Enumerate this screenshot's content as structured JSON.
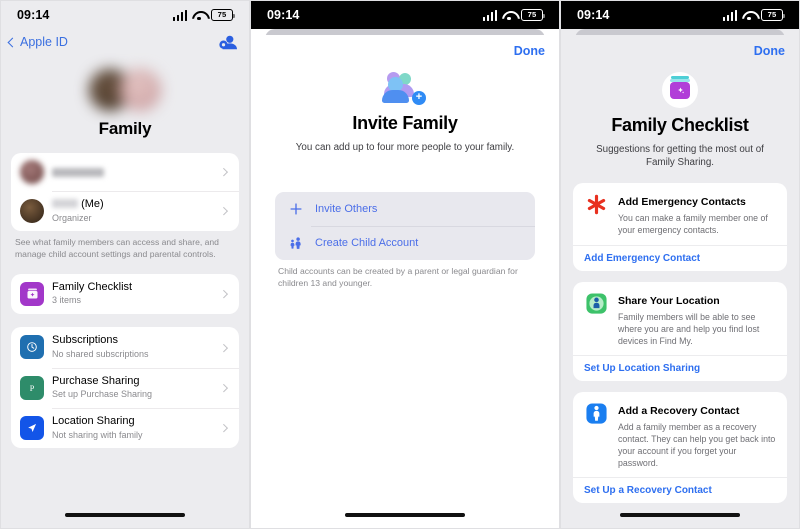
{
  "status_bar": {
    "time": "09:14",
    "battery": "75",
    "signal_icon": "cellular-bars-icon",
    "wifi_icon": "wifi-icon",
    "battery_icon": "battery-icon"
  },
  "screen1": {
    "back_label": "Apple ID",
    "add_member_icon": "add-person-icon",
    "title": "Family",
    "members": [
      {
        "name": "",
        "subtitle": "",
        "blurred": true
      },
      {
        "name": "(Me)",
        "subtitle": "Organizer",
        "blurred": false
      }
    ],
    "members_footnote": "See what family members can access and share, and manage child account settings and parental controls.",
    "checklist": {
      "title": "Family Checklist",
      "subtitle": "3 items",
      "icon": "checklist-jar-icon"
    },
    "features": [
      {
        "title": "Subscriptions",
        "subtitle": "No shared subscriptions",
        "icon": "subscriptions-icon",
        "color": "#1f6fb0"
      },
      {
        "title": "Purchase Sharing",
        "subtitle": "Set up Purchase Sharing",
        "icon": "purchase-sharing-icon",
        "color": "#2e8c6a"
      },
      {
        "title": "Location Sharing",
        "subtitle": "Not sharing with family",
        "icon": "location-arrow-icon",
        "color": "#1355e8"
      }
    ]
  },
  "screen2": {
    "done_label": "Done",
    "hero_icon": "invite-family-icon",
    "title": "Invite Family",
    "subtitle": "You can add up to four more people to your family.",
    "options": [
      {
        "label": "Invite Others",
        "icon": "plus-icon"
      },
      {
        "label": "Create Child Account",
        "icon": "child-account-icon"
      }
    ],
    "options_footnote": "Child accounts can be created by a parent or legal guardian for children 13 and younger."
  },
  "screen3": {
    "done_label": "Done",
    "hero_icon": "family-checklist-icon",
    "title": "Family Checklist",
    "subtitle": "Suggestions for getting the most out of Family Sharing.",
    "cards": [
      {
        "title": "Add Emergency Contacts",
        "description": "You can make a family member one of your emergency contacts.",
        "action": "Add Emergency Contact",
        "icon": "medical-asterisk-icon",
        "color": "#e8301f"
      },
      {
        "title": "Share Your Location",
        "description": "Family members will be able to see where you are and help you find lost devices in Find My.",
        "action": "Set Up Location Sharing",
        "icon": "find-my-icon",
        "color": "#3dc26a"
      },
      {
        "title": "Add a Recovery Contact",
        "description": "Add a family member as a recovery contact. They can help you get back into your account if you forget your password.",
        "action": "Set Up a Recovery Contact",
        "icon": "recovery-contact-icon",
        "color": "#1a7ef0"
      }
    ]
  },
  "colors": {
    "accent_blue": "#2e6ff0",
    "link_blue": "#4b6ee8",
    "page_bg": "#ececef"
  }
}
